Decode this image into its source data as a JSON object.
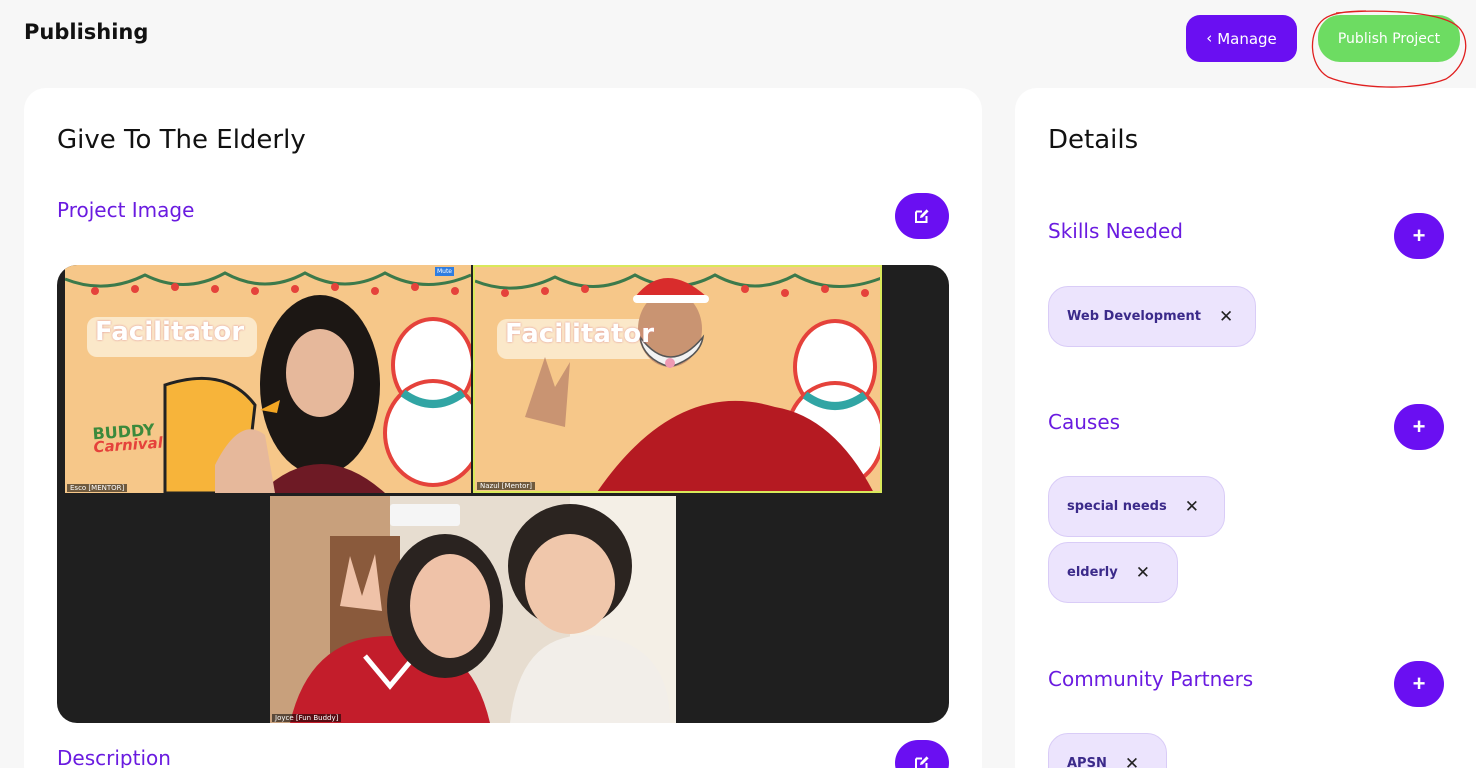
{
  "header": {
    "title": "Publishing",
    "manage_label": "Manage",
    "publish_label": "Publish Project"
  },
  "project": {
    "title": "Give To The Elderly",
    "image_label": "Project Image",
    "description_label": "Description",
    "image": {
      "tiles": [
        {
          "backdrop_text": "Facilitator",
          "name_label": "Esco [MENTOR]",
          "badge": "Mute"
        },
        {
          "backdrop_text": "Facilitator",
          "name_label": "Nazul [Mentor]"
        },
        {
          "name_label": "Joyce [Fun Buddy]"
        }
      ],
      "brand_text_top": "BUDDY",
      "brand_text_bottom": "Carnival"
    }
  },
  "details": {
    "title": "Details",
    "skills": {
      "label": "Skills Needed",
      "items": [
        "Web Development"
      ]
    },
    "causes": {
      "label": "Causes",
      "items": [
        "special needs",
        "elderly"
      ]
    },
    "partners": {
      "label": "Community Partners",
      "items": [
        "APSN"
      ]
    }
  },
  "colors": {
    "primary": "#6a0ff2",
    "publish": "#6ddc62",
    "tag_bg": "#ece4fd",
    "section_label": "#6a1be0",
    "annotation": "#e02020"
  },
  "icons": {
    "manage": "chevron-left-icon",
    "edit": "edit-icon",
    "add": "plus-icon",
    "remove": "close-icon"
  }
}
